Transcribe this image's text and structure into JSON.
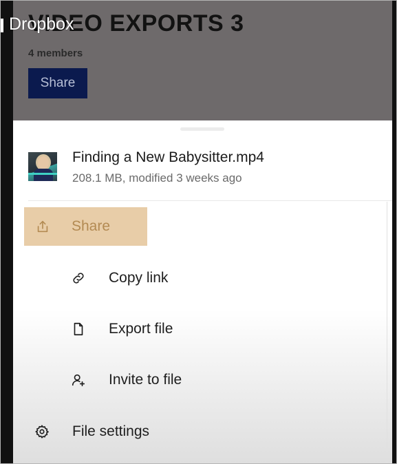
{
  "app": {
    "label": "Dropbox"
  },
  "folder": {
    "title": "VIDEO EXPORTS 3",
    "members": "4 members",
    "share_label": "Share"
  },
  "file": {
    "name": "Finding a New Babysitter.mp4",
    "meta": "208.1 MB, modified 3 weeks ago"
  },
  "menu": {
    "share": {
      "label": "Share",
      "icon": "share-icon"
    },
    "copy_link": {
      "label": "Copy link",
      "icon": "link-icon"
    },
    "export_file": {
      "label": "Export file",
      "icon": "file-icon"
    },
    "invite": {
      "label": "Invite to file",
      "icon": "add-person-icon"
    },
    "settings": {
      "label": "File settings",
      "icon": "gear-icon"
    }
  },
  "colors": {
    "share_highlight_bg": "#e8cda8",
    "share_highlight_text": "#b38a52",
    "folder_share_button": "#0b1a4e",
    "overlay_dim": "#6e6a6b"
  }
}
